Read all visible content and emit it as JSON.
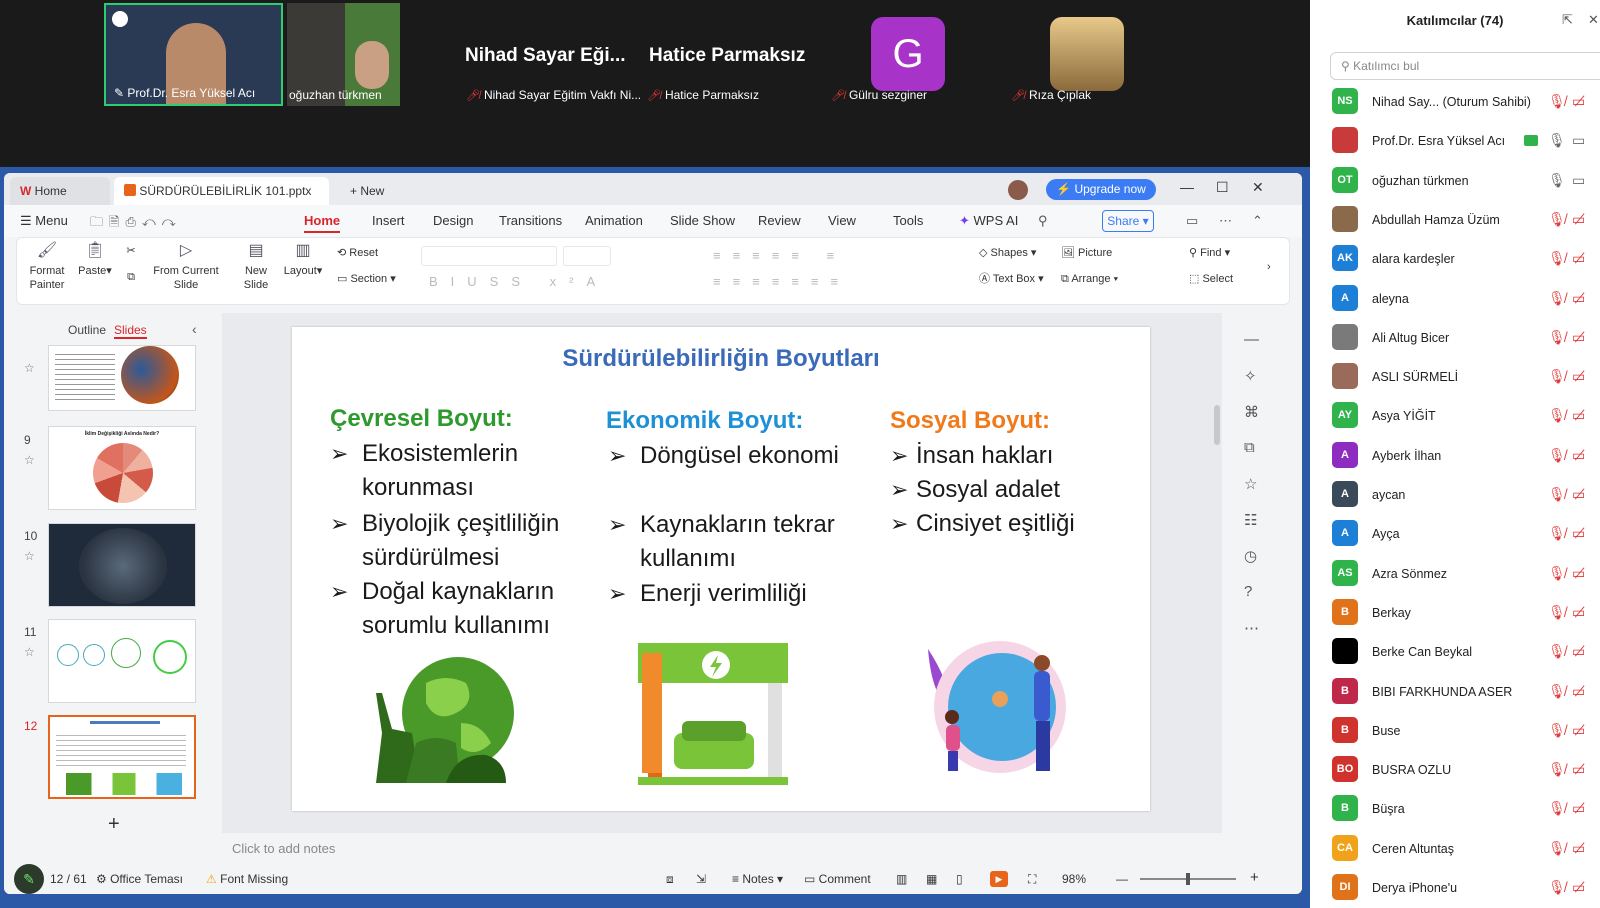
{
  "zoom_gallery": {
    "tiles": [
      {
        "name": "Prof.Dr. Esra Yüksel Acı",
        "muted": false
      },
      {
        "name": "oğuzhan türkmen",
        "muted": false
      },
      {
        "name": "Nihad Sayar Eğitim Vakfı Ni...",
        "muted": true,
        "display_name": "Nihad Sayar Eği..."
      },
      {
        "name": "Hatice Parmaksız",
        "muted": true,
        "display_name": "Hatice Parmaksız"
      },
      {
        "name": "Gülru sezginer",
        "muted": true,
        "avatar_letter": "G"
      },
      {
        "name": "Rıza Çıplak",
        "muted": true
      }
    ]
  },
  "wps": {
    "tabs": {
      "home": "Home",
      "doc": "SÜRDÜRÜLEBİLİRLİK 101.pptx",
      "new": "New"
    },
    "upgrade": "Upgrade now",
    "menu": [
      "Menu",
      "Home",
      "Insert",
      "Design",
      "Transitions",
      "Animation",
      "Slide Show",
      "Review",
      "View",
      "Tools",
      "WPS AI"
    ],
    "share": "Share",
    "ribbon": {
      "format_painter": "Format Painter",
      "paste": "Paste",
      "from_current_slide": "From Current Slide",
      "new_slide": "New Slide",
      "layout": "Layout",
      "reset": "Reset",
      "section": "Section",
      "shapes": "Shapes",
      "picture": "Picture",
      "text_box": "Text Box",
      "arrange": "Arrange",
      "find": "Find",
      "select": "Select"
    },
    "panel_tabs": {
      "outline": "Outline",
      "slides": "Slides"
    },
    "thumbnails": [
      {
        "num": ""
      },
      {
        "num": "9",
        "title": "İklim Değişikliği Aslında Nedir?"
      },
      {
        "num": "10"
      },
      {
        "num": "11"
      },
      {
        "num": "12"
      }
    ],
    "notes_placeholder": "Click to add notes",
    "status": {
      "slide_count": "12 / 61",
      "theme": "Office Teması",
      "font_missing": "Font Missing",
      "notes": "Notes",
      "comment": "Comment",
      "zoom": "98%"
    }
  },
  "slide": {
    "title": "Sürdürülebilirliğin Boyutları",
    "columns": [
      {
        "heading": "Çevresel Boyut:",
        "color": "#2e9a2e",
        "items": [
          "Ekosistemlerin korunması",
          "Biyolojik çeşitliliğin sürdürülmesi",
          "Doğal kaynakların sorumlu kullanımı"
        ]
      },
      {
        "heading": "Ekonomik Boyut:",
        "color": "#1e90d6",
        "items": [
          "Döngüsel ekonomi",
          "Kaynakların tekrar kullanımı",
          "Enerji verimliliği"
        ]
      },
      {
        "heading": "Sosyal Boyut:",
        "color": "#f07a1a",
        "items": [
          "İnsan hakları",
          "Sosyal adalet",
          "Cinsiyet eşitliği"
        ]
      }
    ]
  },
  "participants": {
    "title": "Katılımcılar (74)",
    "search_placeholder": "Katılımcı bul",
    "list": [
      {
        "initials": "NS",
        "color": "#2fb34a",
        "name": "Nihad Say...  (Oturum Sahibi)"
      },
      {
        "initials": "",
        "color": "#c93b3b",
        "name": "Prof.Dr. Esra Yüksel Acı"
      },
      {
        "initials": "OT",
        "color": "#2fb34a",
        "name": "oğuzhan türkmen"
      },
      {
        "initials": "",
        "color": "#8a6a4a",
        "name": "Abdullah Hamza Üzüm"
      },
      {
        "initials": "AK",
        "color": "#1e7fd6",
        "name": "alara kardeşler"
      },
      {
        "initials": "A",
        "color": "#1e7fd6",
        "name": "aleyna"
      },
      {
        "initials": "",
        "color": "#7a7a7a",
        "name": "Ali Altug Bicer"
      },
      {
        "initials": "",
        "color": "#9a6a5a",
        "name": "ASLI SÜRMELİ"
      },
      {
        "initials": "AY",
        "color": "#2fb34a",
        "name": "Asya YİĞİT"
      },
      {
        "initials": "A",
        "color": "#8e2bc0",
        "name": "Ayberk İlhan"
      },
      {
        "initials": "A",
        "color": "#3b4a5a",
        "name": "aycan"
      },
      {
        "initials": "A",
        "color": "#1e7fd6",
        "name": "Ayça"
      },
      {
        "initials": "AS",
        "color": "#2fb34a",
        "name": "Azra Sönmez"
      },
      {
        "initials": "B",
        "color": "#e0721a",
        "name": "Berkay"
      },
      {
        "initials": "",
        "color": "#000000",
        "name": "Berke Can Beykal"
      },
      {
        "initials": "B",
        "color": "#c0284a",
        "name": "BIBI FARKHUNDA ASER"
      },
      {
        "initials": "B",
        "color": "#d0332e",
        "name": "Buse"
      },
      {
        "initials": "BO",
        "color": "#d0332e",
        "name": "BUSRA OZLU"
      },
      {
        "initials": "B",
        "color": "#2fb34a",
        "name": "Büşra"
      },
      {
        "initials": "CA",
        "color": "#f0a31a",
        "name": "Ceren Altuntaş"
      },
      {
        "initials": "DI",
        "color": "#e0721a",
        "name": "Derya iPhone'u"
      }
    ]
  }
}
